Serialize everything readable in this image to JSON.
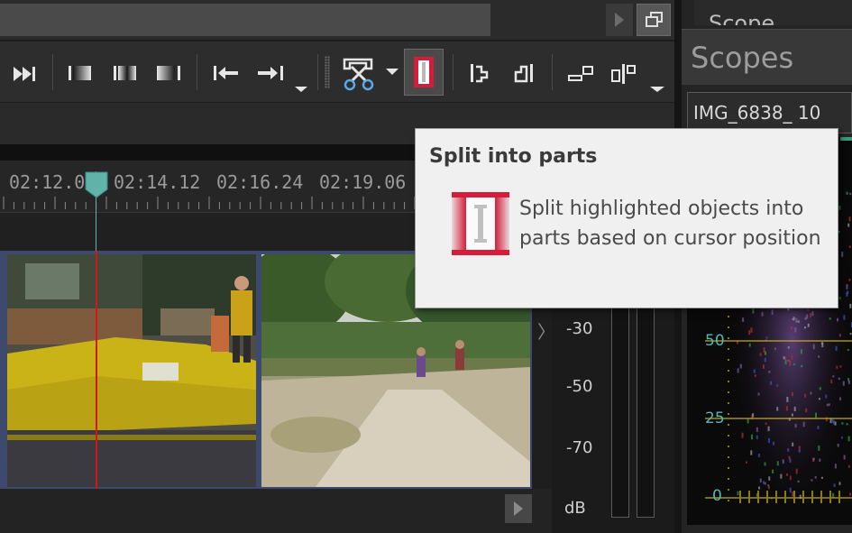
{
  "toolbar": {
    "buttons": [
      {
        "name": "jump-to-end-icon"
      },
      {
        "name": "fade-in-icon"
      },
      {
        "name": "fade-cross-icon"
      },
      {
        "name": "fade-out-icon"
      },
      {
        "name": "move-to-previous-marker-icon"
      },
      {
        "name": "move-to-next-marker-icon"
      },
      {
        "name": "cut-scissors-icon"
      },
      {
        "name": "split-into-parts-icon",
        "active": true
      },
      {
        "name": "align-left-icon"
      },
      {
        "name": "align-right-icon"
      },
      {
        "name": "insert-marker-icon"
      },
      {
        "name": "snap-to-marker-icon"
      }
    ],
    "accent_color": "#d31e3a"
  },
  "timeline": {
    "ruler_labels": [
      "02:12.00",
      "02:14.12",
      "02:16.24",
      "02:19.06"
    ],
    "playhead_color": "#5fb3a9",
    "cursor_color": "#d01818"
  },
  "meter": {
    "labels": [
      "-30",
      "-50",
      "-70"
    ],
    "unit": "dB"
  },
  "scopes": {
    "title": "Scopes",
    "tab_top": "Scope",
    "source_select": "IMG_6838_ 10",
    "scale_labels": [
      "50",
      "25",
      "0"
    ]
  },
  "tooltip": {
    "title": "Split into parts",
    "body": "Split highlighted objects into parts based on cursor position"
  }
}
